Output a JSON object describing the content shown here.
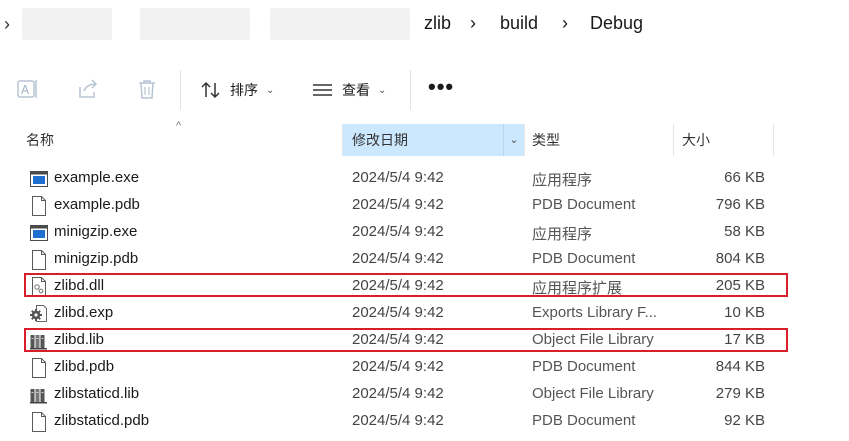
{
  "breadcrumb": {
    "items": [
      "zlib",
      "build",
      "Debug"
    ]
  },
  "toolbar": {
    "sort_label": "排序",
    "view_label": "查看",
    "more_label": "•••"
  },
  "columns": {
    "name": "名称",
    "date": "修改日期",
    "type": "类型",
    "size": "大小"
  },
  "files": [
    {
      "name": "example.exe",
      "date": "2024/5/4 9:42",
      "type": "应用程序",
      "size": "66 KB",
      "icon": "exe-icon"
    },
    {
      "name": "example.pdb",
      "date": "2024/5/4 9:42",
      "type": "PDB Document",
      "size": "796 KB",
      "icon": "document-icon"
    },
    {
      "name": "minigzip.exe",
      "date": "2024/5/4 9:42",
      "type": "应用程序",
      "size": "58 KB",
      "icon": "exe-icon"
    },
    {
      "name": "minigzip.pdb",
      "date": "2024/5/4 9:42",
      "type": "PDB Document",
      "size": "804 KB",
      "icon": "document-icon"
    },
    {
      "name": "zlibd.dll",
      "date": "2024/5/4 9:42",
      "type": "应用程序扩展",
      "size": "205 KB",
      "icon": "dll-icon"
    },
    {
      "name": "zlibd.exp",
      "date": "2024/5/4 9:42",
      "type": "Exports Library F...",
      "size": "10 KB",
      "icon": "gear-file-icon"
    },
    {
      "name": "zlibd.lib",
      "date": "2024/5/4 9:42",
      "type": "Object File Library",
      "size": "17 KB",
      "icon": "library-icon"
    },
    {
      "name": "zlibd.pdb",
      "date": "2024/5/4 9:42",
      "type": "PDB Document",
      "size": "844 KB",
      "icon": "document-icon"
    },
    {
      "name": "zlibstaticd.lib",
      "date": "2024/5/4 9:42",
      "type": "Object File Library",
      "size": "279 KB",
      "icon": "library-icon"
    },
    {
      "name": "zlibstaticd.pdb",
      "date": "2024/5/4 9:42",
      "type": "PDB Document",
      "size": "92 KB",
      "icon": "document-icon"
    }
  ],
  "colors": {
    "highlight": "#d61f2a",
    "selected_header": "#cce8ff",
    "exe_blue": "#1f6fd1"
  }
}
